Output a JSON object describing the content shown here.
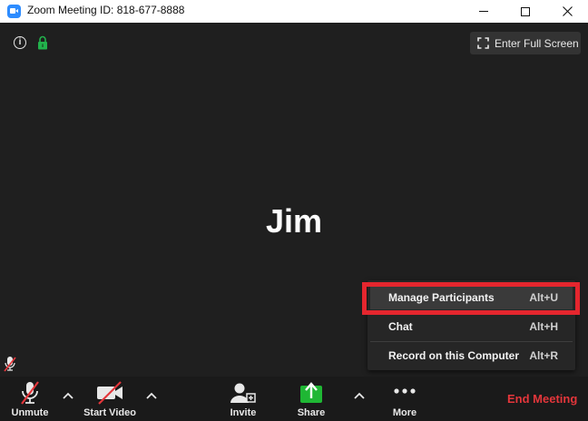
{
  "window": {
    "title": "Zoom Meeting ID: 818-677-8888",
    "app_icon": "zoom-logo-icon",
    "controls": [
      "minimize-icon",
      "maximize-icon",
      "close-icon"
    ]
  },
  "stage": {
    "participant_name": "Jim",
    "fullscreen_label": "Enter Full Screen",
    "icons": [
      "info-icon",
      "lock-icon",
      "fullscreen-icon",
      "muted-mic-icon"
    ]
  },
  "more_menu": {
    "items": [
      {
        "label": "Manage Participants",
        "shortcut": "Alt+U",
        "highlighted": true
      },
      {
        "label": "Chat",
        "shortcut": "Alt+H",
        "highlighted": false
      },
      {
        "label": "Record on this Computer",
        "shortcut": "Alt+R",
        "highlighted": false
      }
    ]
  },
  "toolbar": {
    "unmute_label": "Unmute",
    "start_video_label": "Start Video",
    "invite_label": "Invite",
    "share_label": "Share",
    "more_label": "More",
    "end_meeting_label": "End Meeting"
  },
  "colors": {
    "accent": "#2d8cff",
    "share_green": "#1fb734",
    "end_red": "#e4363b",
    "highlight_red": "#e5262e",
    "lock_green": "#22b14c"
  }
}
